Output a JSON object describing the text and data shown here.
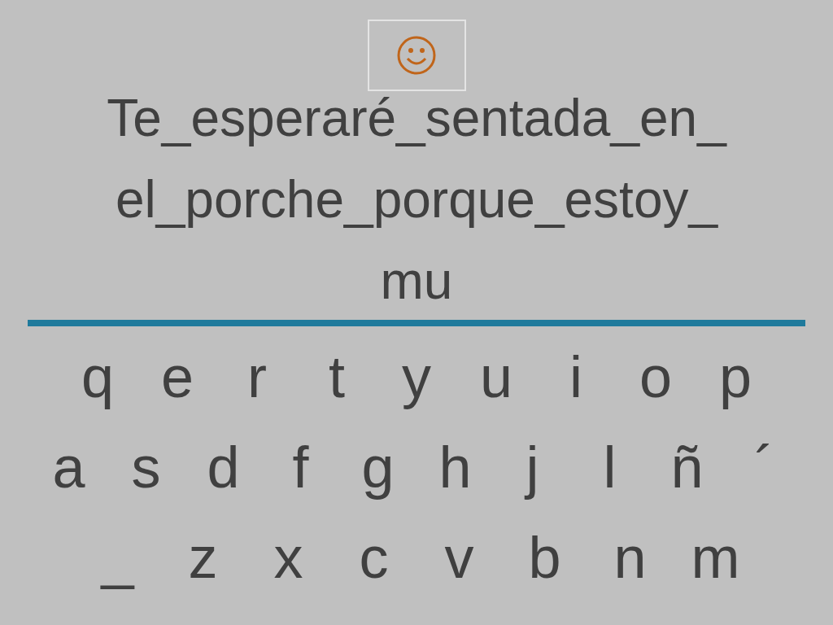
{
  "sentence_lines": [
    "Te_esperaré_sentada_en_",
    "el_porche_porque_estoy_",
    "mu"
  ],
  "keyboard_rows": [
    [
      "q",
      "e",
      "r",
      "t",
      "y",
      "u",
      "i",
      "o",
      "p"
    ],
    [
      "a",
      "s",
      "d",
      "f",
      "g",
      "h",
      "j",
      "l",
      "ñ",
      "´"
    ],
    [
      "_",
      "z",
      "x",
      "c",
      "v",
      "b",
      "n",
      "m"
    ]
  ]
}
